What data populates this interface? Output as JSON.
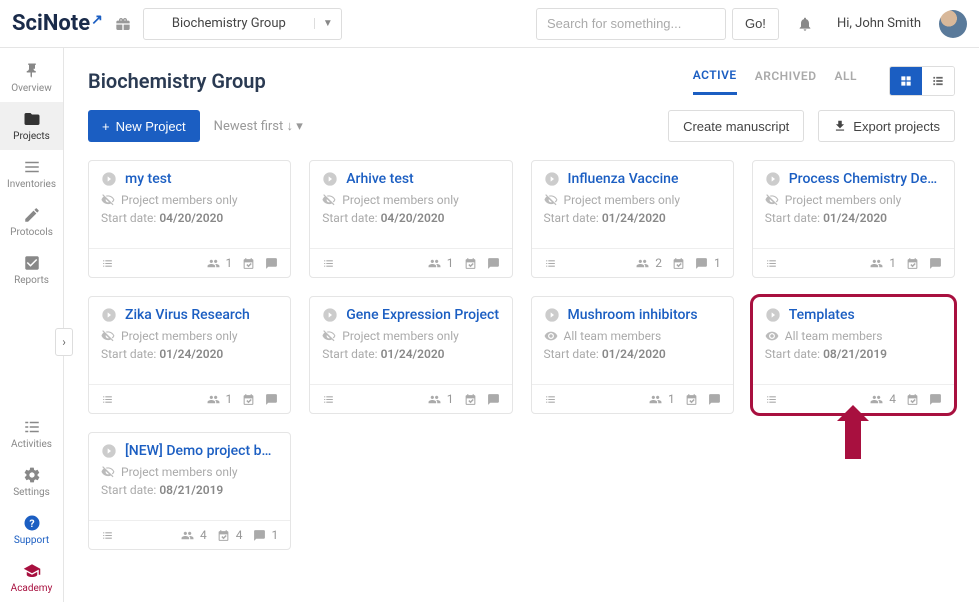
{
  "brand": "SciNote",
  "team_selector": {
    "label": "Biochemistry Group"
  },
  "search": {
    "placeholder": "Search for something...",
    "go_label": "Go!"
  },
  "greeting": "Hi, John Smith",
  "sidebar": {
    "items": [
      {
        "label": "Overview"
      },
      {
        "label": "Projects"
      },
      {
        "label": "Inventories"
      },
      {
        "label": "Protocols"
      },
      {
        "label": "Reports"
      }
    ],
    "bottom": [
      {
        "label": "Activities"
      },
      {
        "label": "Settings"
      },
      {
        "label": "Support"
      },
      {
        "label": "Academy"
      }
    ]
  },
  "page": {
    "title": "Biochemistry Group",
    "tabs": {
      "active": "ACTIVE",
      "archived": "ARCHIVED",
      "all": "ALL"
    },
    "new_project": "New Project",
    "sort": "Newest first ↓ ▾",
    "create_manuscript": "Create manuscript",
    "export_projects": "Export projects"
  },
  "projects": [
    {
      "title": "my test",
      "visibility": "Project members only",
      "vis_type": "private",
      "date": "04/20/2020",
      "members": 1,
      "cal": null,
      "comments": null
    },
    {
      "title": "Arhive test",
      "visibility": "Project members only",
      "vis_type": "private",
      "date": "04/20/2020",
      "members": 1,
      "cal": null,
      "comments": null
    },
    {
      "title": "Influenza Vaccine",
      "visibility": "Project members only",
      "vis_type": "private",
      "date": "01/24/2020",
      "members": 2,
      "cal": null,
      "comments": 1
    },
    {
      "title": "Process Chemistry De…",
      "visibility": "Project members only",
      "vis_type": "private",
      "date": "01/24/2020",
      "members": 1,
      "cal": null,
      "comments": null
    },
    {
      "title": "Zika Virus Research",
      "visibility": "Project members only",
      "vis_type": "private",
      "date": "01/24/2020",
      "members": 1,
      "cal": null,
      "comments": null
    },
    {
      "title": "Gene Expression Project",
      "visibility": "Project members only",
      "vis_type": "private",
      "date": "01/24/2020",
      "members": 1,
      "cal": null,
      "comments": null
    },
    {
      "title": "Mushroom inhibitors",
      "visibility": "All team members",
      "vis_type": "public",
      "date": "01/24/2020",
      "members": 1,
      "cal": null,
      "comments": null
    },
    {
      "title": "Templates",
      "visibility": "All team members",
      "vis_type": "public",
      "date": "08/21/2019",
      "members": 4,
      "cal": null,
      "comments": null,
      "highlight": true
    },
    {
      "title": "[NEW] Demo project b…",
      "visibility": "Project members only",
      "vis_type": "private",
      "date": "08/21/2019",
      "members": 4,
      "cal": 4,
      "comments": 1
    }
  ],
  "labels": {
    "start_date": "Start date: "
  }
}
